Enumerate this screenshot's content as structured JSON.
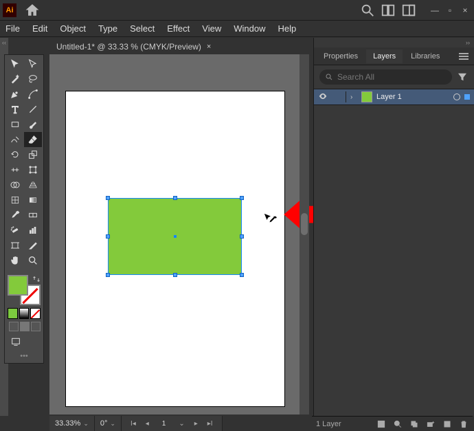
{
  "app": {
    "logo": "Ai"
  },
  "menus": {
    "items": [
      "File",
      "Edit",
      "Object",
      "Type",
      "Select",
      "Effect",
      "View",
      "Window",
      "Help"
    ]
  },
  "doc_tab": {
    "title": "Untitled-1* @ 33.33 % (CMYK/Preview)",
    "close": "×"
  },
  "panels": {
    "tabs": {
      "properties": "Properties",
      "layers": "Layers",
      "libraries": "Libraries"
    },
    "search": {
      "placeholder": "Search All"
    },
    "layer": {
      "name": "Layer 1"
    },
    "footer": {
      "count": "1 Layer"
    }
  },
  "status": {
    "zoom": "33.33%",
    "rotation": "0°",
    "artboard": "1"
  },
  "colors": {
    "fill": "#83ca3b",
    "shape": "#83ca3b",
    "arrow": "#ff0000"
  },
  "tools": [
    [
      "selection",
      "direct-selection"
    ],
    [
      "magic-wand",
      "lasso"
    ],
    [
      "pen",
      "curvature"
    ],
    [
      "type",
      "line-segment"
    ],
    [
      "rectangle",
      "paintbrush"
    ],
    [
      "shaper",
      "eraser"
    ],
    [
      "rotate",
      "scale"
    ],
    [
      "width",
      "free-transform"
    ],
    [
      "shape-builder",
      "perspective"
    ],
    [
      "mesh",
      "gradient"
    ],
    [
      "eyedropper",
      "blend"
    ],
    [
      "symbol-sprayer",
      "column-graph"
    ],
    [
      "artboard",
      "slice"
    ],
    [
      "hand",
      "zoom"
    ]
  ]
}
